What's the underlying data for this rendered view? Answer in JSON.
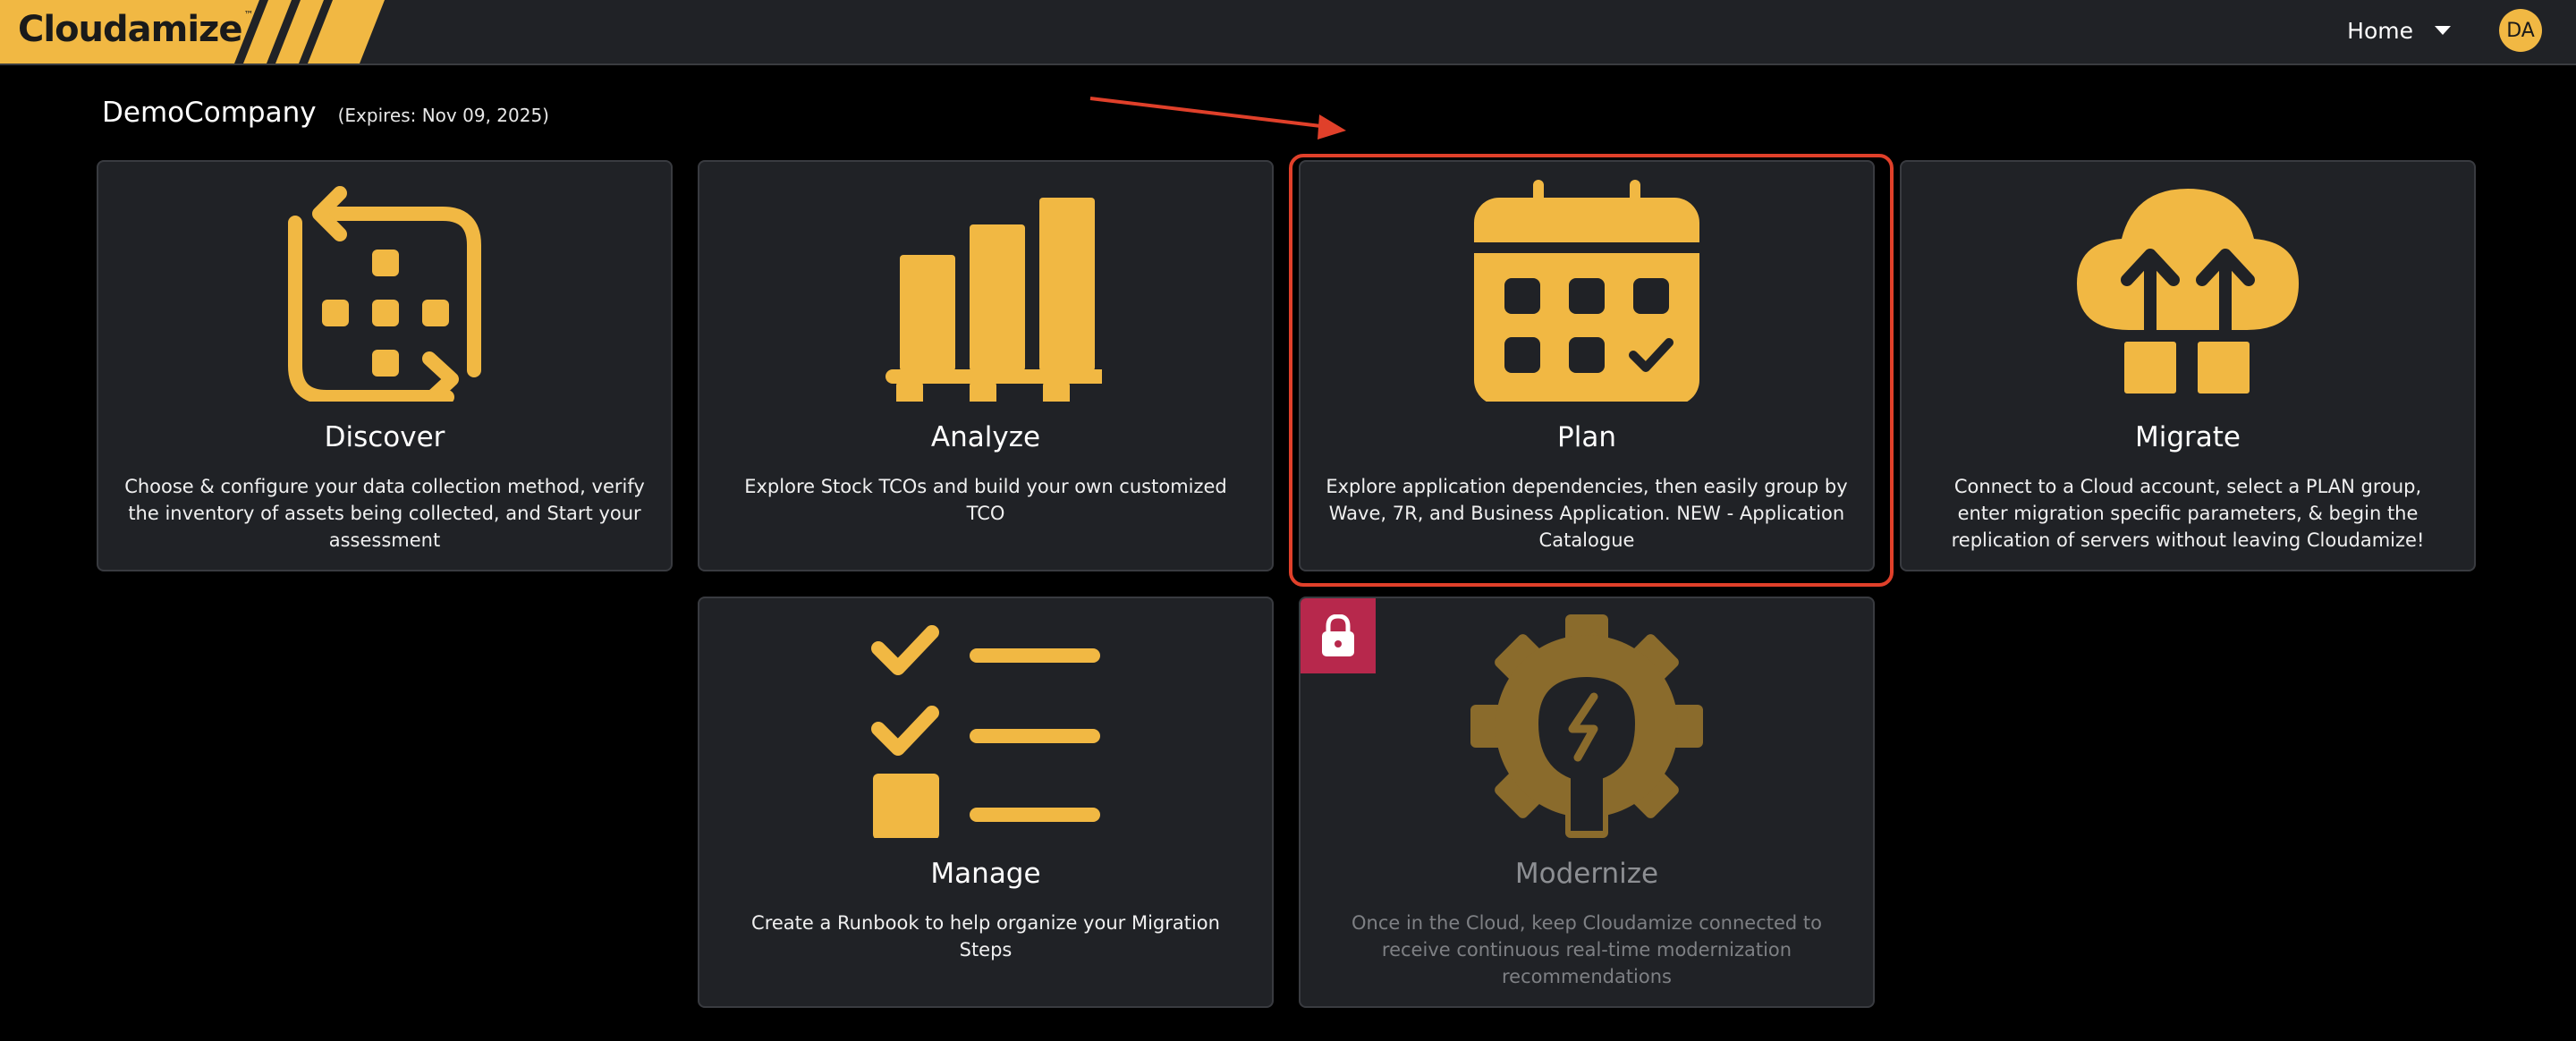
{
  "header": {
    "logo_text": "Cloudamize",
    "logo_tm": "™",
    "nav_label": "Home",
    "avatar_initials": "DA"
  },
  "company": {
    "name": "DemoCompany",
    "expires": "(Expires: Nov 09, 2025)"
  },
  "colors": {
    "accent": "#f1b843",
    "card_bg": "#202226",
    "highlight": "#e0402a",
    "lock_badge": "#b7284c"
  },
  "cards": [
    {
      "title": "Discover",
      "icon": "discover-cycle-icon",
      "description": "Choose & configure your data collection method, verify the inventory of assets being collected, and Start your assessment",
      "locked": false
    },
    {
      "title": "Analyze",
      "icon": "bar-chart-icon",
      "description": "Explore Stock TCOs and build your own customized TCO",
      "locked": false
    },
    {
      "title": "Plan",
      "icon": "calendar-icon",
      "description": "Explore application dependencies, then easily group by Wave, 7R, and Business Application. NEW - Application Catalogue",
      "locked": false,
      "highlighted": true
    },
    {
      "title": "Migrate",
      "icon": "cloud-upload-icon",
      "description": "Connect to a Cloud account, select a PLAN group, enter migration specific parameters, & begin the replication of servers without leaving Cloudamize!",
      "locked": false
    },
    {
      "title": "Manage",
      "icon": "checklist-icon",
      "description": "Create a Runbook to help organize your Migration Steps",
      "locked": false
    },
    {
      "title": "Modernize",
      "icon": "gear-bulb-icon",
      "description": "Once in the Cloud, keep Cloudamize connected to receive continuous real-time modernization recommendations",
      "locked": true
    }
  ]
}
